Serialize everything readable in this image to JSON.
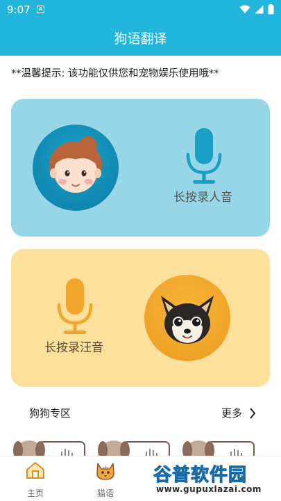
{
  "status_bar": {
    "time": "9:07",
    "notification_badge": "A"
  },
  "app_bar": {
    "title": "狗语翻译"
  },
  "tip": "**温馨提示: 该功能仅供您和宠物娱乐使用哦**",
  "human_card": {
    "label": "长按录人音",
    "avatar_icon": "girl-avatar-icon",
    "mic_icon": "microphone-icon",
    "color": "#97d7e7"
  },
  "dog_card": {
    "label": "长按录汪音",
    "avatar_icon": "dog-avatar-icon",
    "mic_icon": "microphone-icon",
    "color": "#fde09c"
  },
  "section": {
    "title": "狗狗专区",
    "more_label": "更多"
  },
  "tabs": [
    {
      "label": "主页",
      "icon": "home-icon"
    },
    {
      "label": "猫语",
      "icon": "cat-icon"
    }
  ],
  "watermark": {
    "logo": "谷普软件园",
    "url": "www.gupuxlazai.com"
  },
  "colors": {
    "primary": "#23b6dc",
    "mic_blue": "#1a9fc5",
    "mic_orange": "#f1a52b"
  }
}
